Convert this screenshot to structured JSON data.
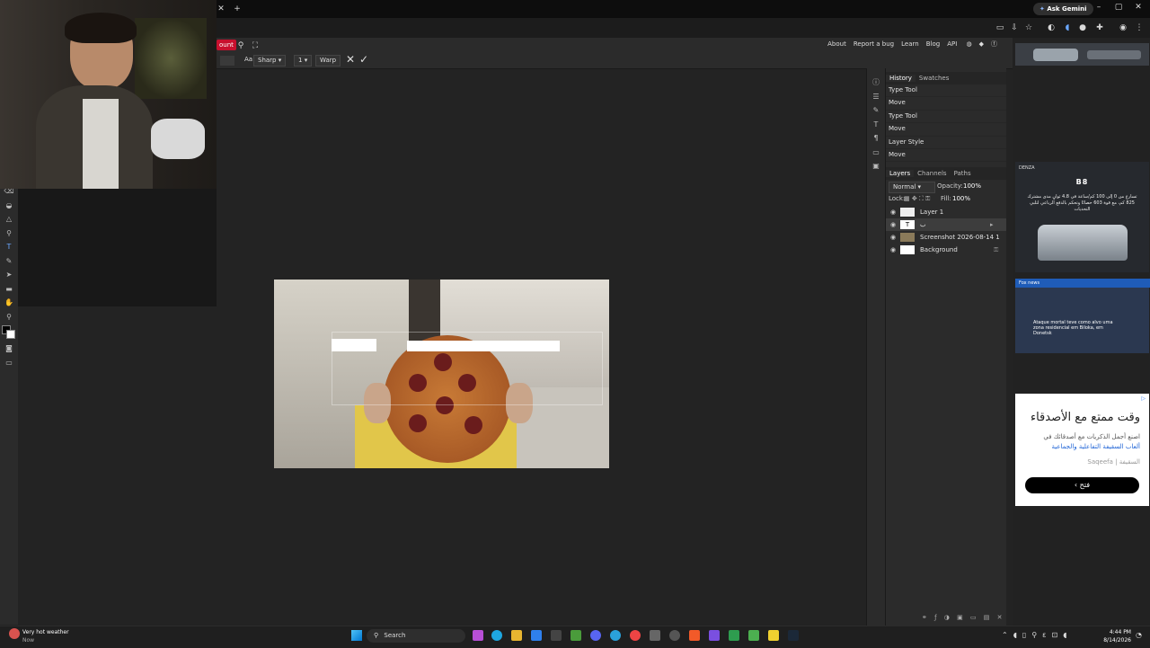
{
  "browser": {
    "ask_gemini": "Ask Gemini",
    "window_controls": [
      "–",
      "▢",
      "✕"
    ]
  },
  "photopea": {
    "menu_tab_label": "ount",
    "options": {
      "aa_label": "Aa:",
      "antialias": "Sharp",
      "size": "1",
      "warp_label": "Warp"
    },
    "top_links": [
      "About",
      "Report a bug",
      "Learn",
      "Blog",
      "API"
    ],
    "history": {
      "tabs": [
        "History",
        "Swatches"
      ],
      "items": [
        "Type Tool",
        "Move",
        "Type Tool",
        "Move",
        "Layer Style",
        "Move"
      ]
    },
    "layers": {
      "tabs": [
        "Layers",
        "Channels",
        "Paths"
      ],
      "blend_mode": "Normal",
      "opacity_label": "Opacity:",
      "opacity_value": "100%",
      "lock_label": "Lock:",
      "fill_label": "Fill:",
      "fill_value": "100%",
      "items": [
        {
          "name": "Layer 1"
        },
        {
          "name": "ب"
        },
        {
          "name": "Screenshot 2026-08-14 1"
        },
        {
          "name": "Background"
        }
      ]
    }
  },
  "ads": {
    "denza": {
      "brand": "DENZA",
      "model": "B8",
      "text": "تسارع من 0 إلى 100 كم/ساعة في 4.8 ثوانٍ مدى مشترك 825 كم، مع قوة 603 حصانًا وتحكم بالدفع الرباعي لتلبي التحديات"
    },
    "news": {
      "source": "Fox news",
      "headline": "Ataque mortal teve como alvo uma zona residencial em Biloka, em Donetsk"
    },
    "game": {
      "title": "وقت ممتع مع الأصدقاء",
      "line1": "اصنع أجمل الذكريات مع أصدقائك في",
      "line2": "ألعاب السقيفة التفاعلية والجماعية",
      "brand": "السقيفة | Saqeefa",
      "button": "فتح"
    }
  },
  "taskbar": {
    "weather_title": "Very hot weather",
    "weather_sub": "Now",
    "search_label": "Search",
    "time": "4:44 PM",
    "date": "8/14/2026"
  },
  "colors": {
    "background": "#232323",
    "panel": "#2b2b2b",
    "accent_red": "#c8102e",
    "taskbar": "#1f1f1f"
  }
}
